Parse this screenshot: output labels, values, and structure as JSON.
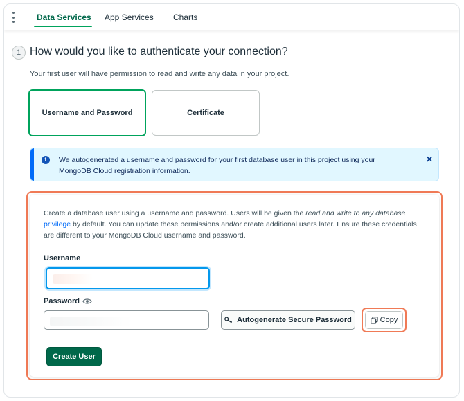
{
  "tabs": [
    {
      "label": "Data Services",
      "active": true
    },
    {
      "label": "App Services",
      "active": false
    },
    {
      "label": "Charts",
      "active": false
    }
  ],
  "step": {
    "number": "1",
    "title": "How would you like to authenticate your connection?",
    "subtitle": "Your first user will have permission to read and write any data in your project."
  },
  "auth_options": {
    "username_password": "Username and Password",
    "certificate": "Certificate",
    "selected": "username_password"
  },
  "banner": {
    "icon": "info-icon",
    "text": "We autogenerated a username and password for your first database user in this project using your MongoDB Cloud registration information.",
    "close": "✕"
  },
  "form": {
    "desc_part1": "Create a database user using a username and password. Users will be given the ",
    "desc_emphasis": "read and write to any database",
    "desc_link": "privilege",
    "desc_part2": " by default. You can update these permissions and/or create additional users later. Ensure these credentials are different to your MongoDB Cloud username and password.",
    "username_label": "Username",
    "username_value": "",
    "password_label": "Password",
    "password_value": "",
    "autogenerate_label": "Autogenerate Secure Password",
    "copy_label": "Copy",
    "create_label": "Create User"
  },
  "colors": {
    "brand_green": "#00684a",
    "active_tab_underline": "#00a35c",
    "highlight": "#f07a56",
    "info_bg": "#e1f7ff",
    "info_bar": "#016bf8"
  }
}
